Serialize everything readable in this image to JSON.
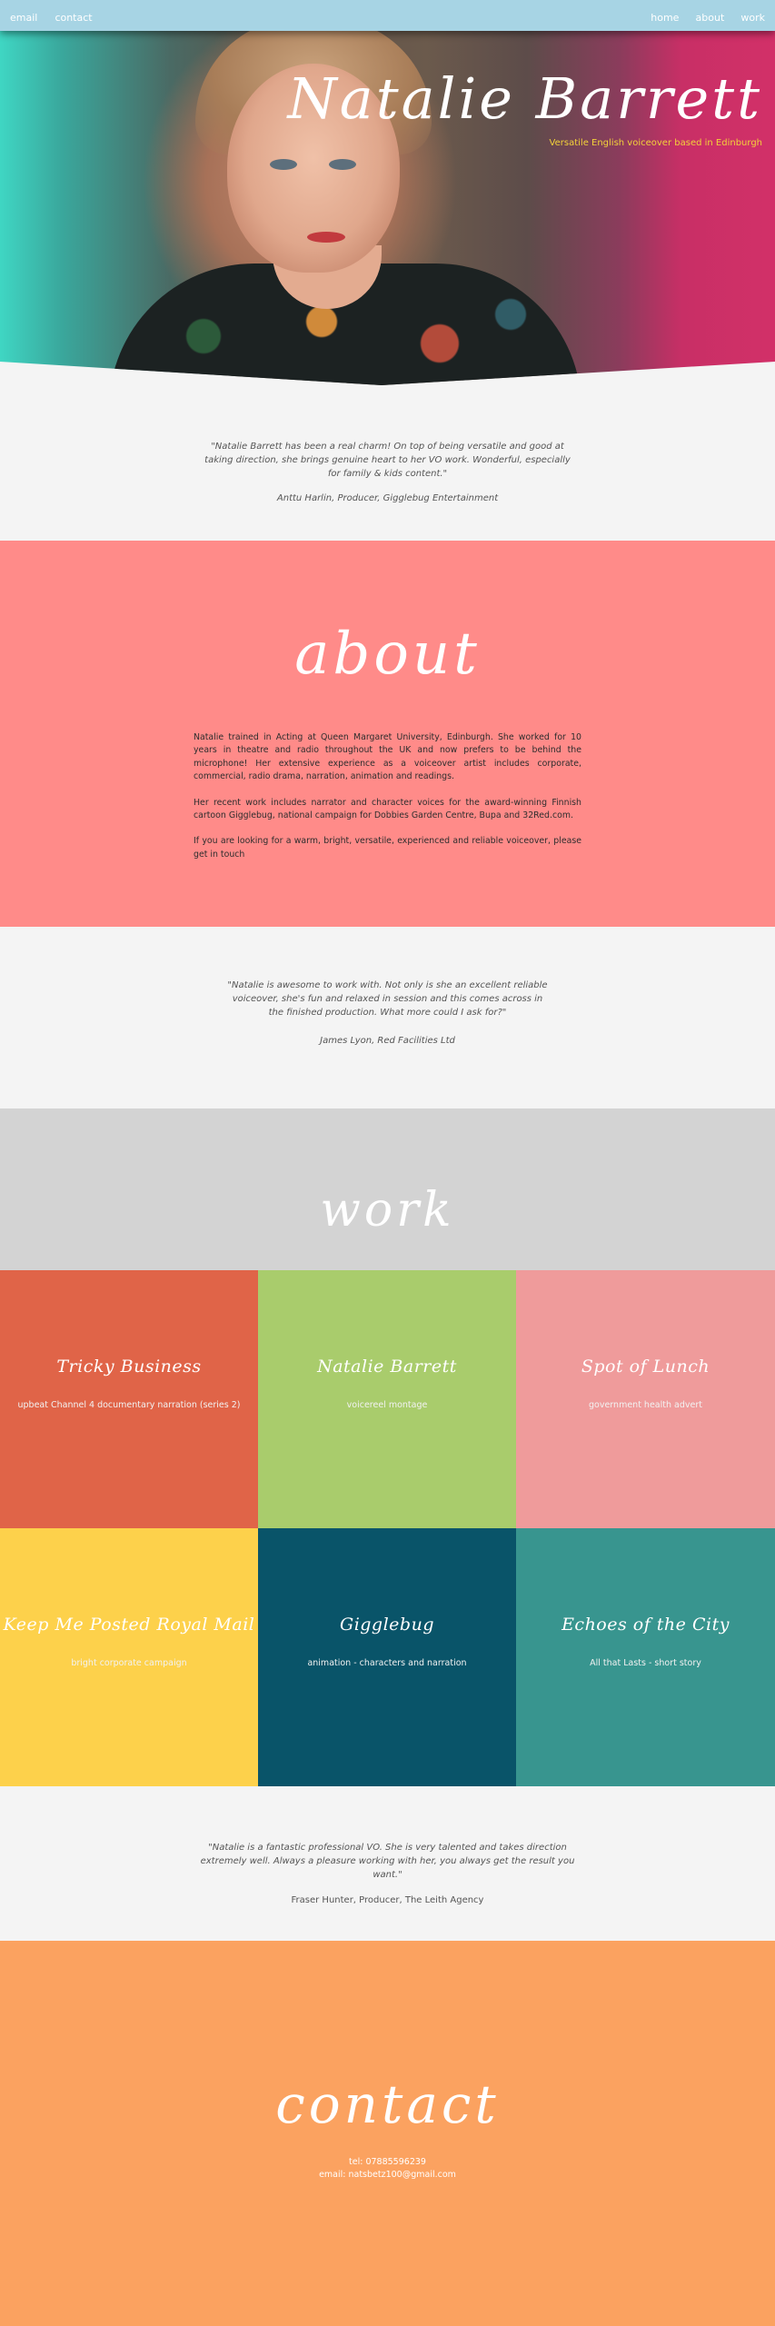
{
  "nav": {
    "left": [
      "email",
      "contact"
    ],
    "right": [
      "home",
      "about",
      "work"
    ]
  },
  "hero": {
    "title": "Natalie Barrett",
    "subtitle": "Versatile English voiceover based in Edinburgh",
    "accent_color": "#f3d23a"
  },
  "testimonials": [
    {
      "quote": "\"Natalie Barrett has been a real charm! On top of being versatile and good at taking direction, she brings genuine heart to her VO work. Wonderful, especially for family & kids content.\"",
      "author": "Anttu Harlin, Producer, Gigglebug Entertainment"
    },
    {
      "quote": "\"Natalie is awesome to work with. Not only is she an excellent reliable voiceover, she's fun and relaxed in session and this comes across in the finished production. What more could I ask for?\"",
      "author": "James Lyon, Red Facilities Ltd"
    },
    {
      "quote": "\"Natalie is a fantastic professional VO. She is very talented and takes direction extremely well. Always a pleasure working with her, you always get the result you want.\"",
      "author": "Fraser Hunter, Producer, The Leith Agency"
    }
  ],
  "about": {
    "heading": "about",
    "paragraphs": [
      "Natalie trained in Acting at Queen Margaret University, Edinburgh. She worked for 10 years in theatre and radio throughout the UK and now prefers to be behind the microphone! Her extensive experience as a voiceover artist includes corporate, commercial, radio drama, narration, animation and readings.",
      "Her recent work includes narrator and character voices for the award-winning Finnish cartoon Gigglebug, national campaign for Dobbies Garden Centre, Bupa and 32Red.com.",
      "If you are looking for a warm, bright, versatile, experienced and reliable voiceover, please get in touch"
    ],
    "bg_color": "#ff8b89"
  },
  "work": {
    "heading": "work",
    "items": [
      {
        "title": "Tricky Business",
        "desc": "upbeat Channel 4 documentary narration (series 2)",
        "color": "#e06448"
      },
      {
        "title": "Natalie Barrett",
        "desc": "voicereel montage",
        "color": "#a9cc6c"
      },
      {
        "title": "Spot of Lunch",
        "desc": "government health advert",
        "color": "#ef9b9b"
      },
      {
        "title": "Keep Me Posted Royal Mail",
        "desc": "bright corporate campaign",
        "color": "#fdd14b"
      },
      {
        "title": "Gigglebug",
        "desc": "animation - characters and narration",
        "color": "#095469"
      },
      {
        "title": "Echoes of the City",
        "desc": "All that Lasts - short story",
        "color": "#38958f"
      }
    ]
  },
  "contact": {
    "heading": "contact",
    "tel": "tel: 07885596239",
    "email": "email: natsbetz100@gmail.com",
    "bg_color": "#fba260"
  }
}
